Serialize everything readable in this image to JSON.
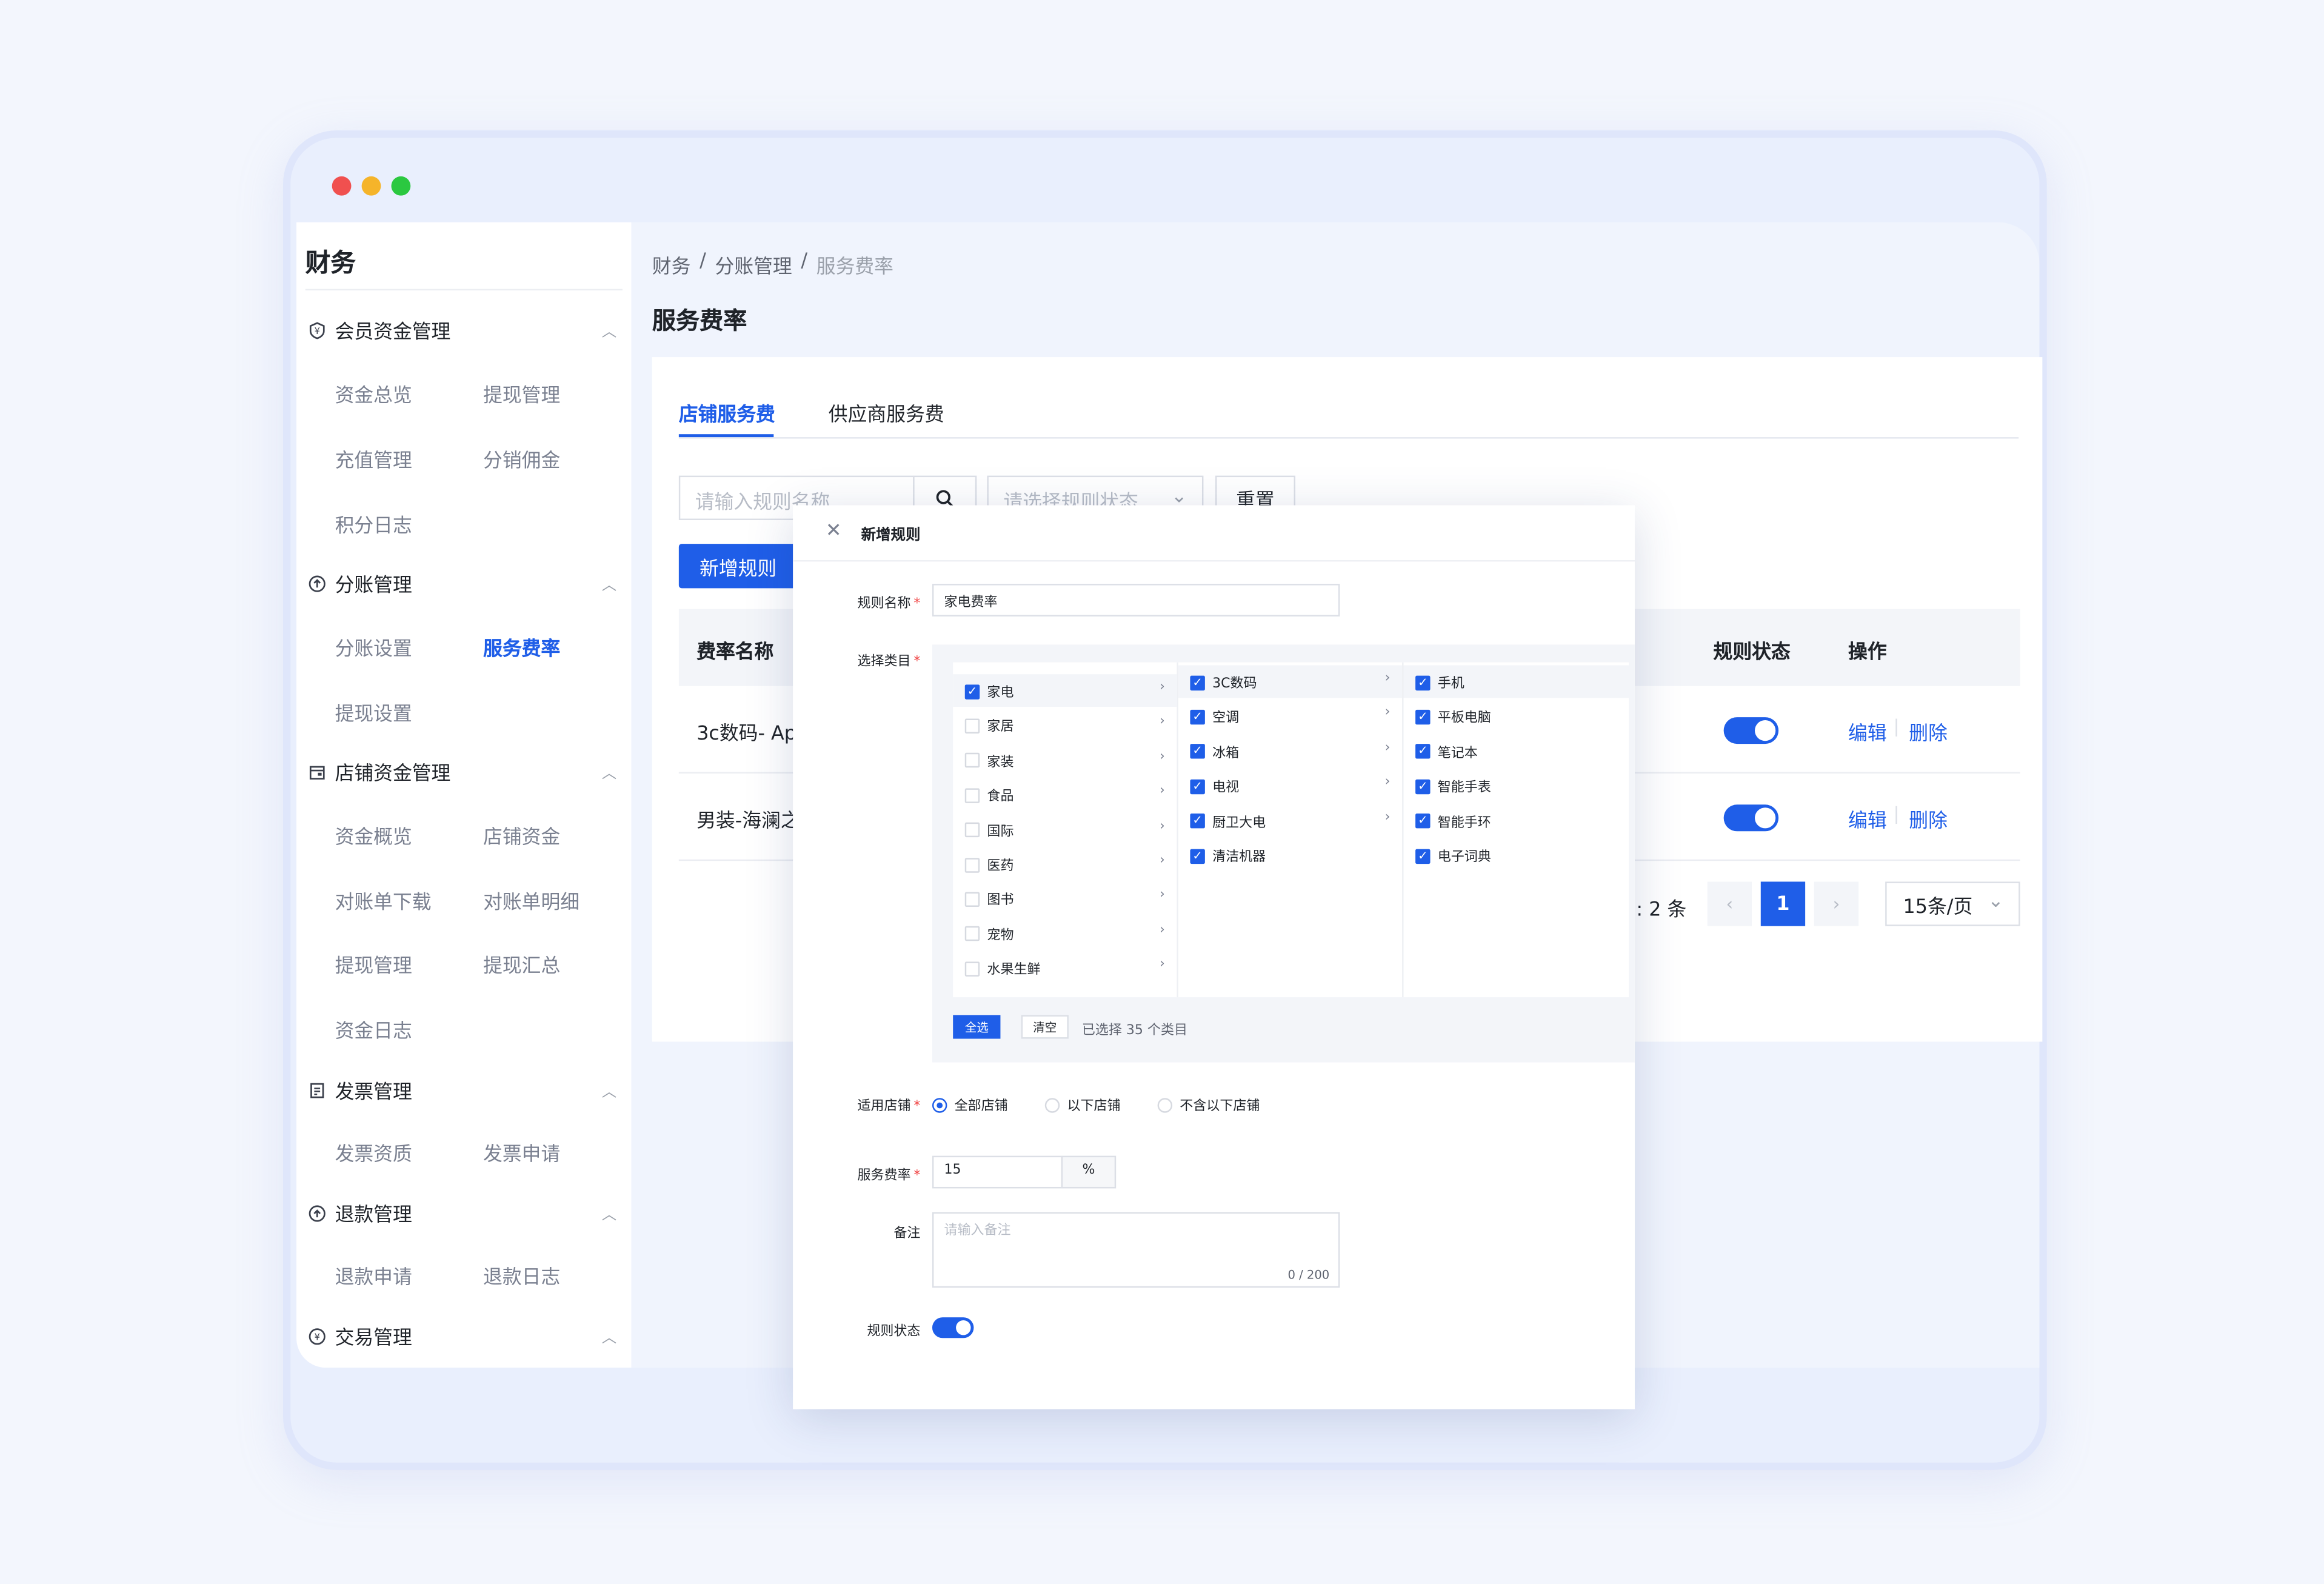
{
  "app": {
    "section_title": "财务"
  },
  "sidebar": {
    "groups": [
      {
        "label": "会员资金管理",
        "items": [
          "资金总览",
          "提现管理",
          "充值管理",
          "分销佣金",
          "积分日志"
        ]
      },
      {
        "label": "分账管理",
        "items": [
          "分账设置",
          "服务费率",
          "提现设置"
        ]
      },
      {
        "label": "店铺资金管理",
        "items": [
          "资金概览",
          "店铺资金",
          "对账单下载",
          "对账单明细",
          "提现管理",
          "提现汇总",
          "资金日志"
        ]
      },
      {
        "label": "发票管理",
        "items": [
          "发票资质",
          "发票申请"
        ]
      },
      {
        "label": "退款管理",
        "items": [
          "退款申请",
          "退款日志"
        ]
      },
      {
        "label": "交易管理",
        "items": []
      }
    ],
    "active_item": "服务费率"
  },
  "breadcrumb": [
    "财务",
    "分账管理",
    "服务费率"
  ],
  "page_title": "服务费率",
  "tabs": [
    "店铺服务费",
    "供应商服务费"
  ],
  "filters": {
    "name_placeholder": "请输入规则名称",
    "status_placeholder": "请选择规则状态",
    "reset_label": "重置"
  },
  "add_rule_label": "新增规则",
  "table": {
    "headers": {
      "name": "费率名称",
      "status": "规则状态",
      "actions": "操作"
    },
    "rows": [
      {
        "name": "3c数码- App",
        "status_on": true
      },
      {
        "name": "男装-海澜之",
        "status_on": true
      }
    ],
    "edit_label": "编辑",
    "delete_label": "删除"
  },
  "pagination": {
    "total_text": ": 2 条",
    "current_page": "1",
    "page_size": "15条/页"
  },
  "modal": {
    "title": "新增规则",
    "rule_name_label": "规则名称",
    "rule_name_value": "家电费率",
    "category_label": "选择类目",
    "col1": [
      "家电",
      "家居",
      "家装",
      "食品",
      "国际",
      "医药",
      "图书",
      "宠物",
      "水果生鲜"
    ],
    "col1_checked": [
      true,
      false,
      false,
      false,
      false,
      false,
      false,
      false,
      false
    ],
    "col2": [
      "3C数码",
      "空调",
      "冰箱",
      "电视",
      "厨卫大电",
      "清洁机器"
    ],
    "col2_arrow": [
      true,
      true,
      true,
      true,
      true,
      false
    ],
    "col3": [
      "手机",
      "平板电脑",
      "笔记本",
      "智能手表",
      "智能手环",
      "电子词典"
    ],
    "select_all_label": "全选",
    "clear_label": "清空",
    "selected_text": "已选择 35 个类目",
    "store_label": "适用店铺",
    "store_options": [
      "全部店铺",
      "以下店铺",
      "不含以下店铺"
    ],
    "store_selected": "全部店铺",
    "rate_label": "服务费率",
    "rate_value": "15",
    "rate_unit": "%",
    "remark_label": "备注",
    "remark_placeholder": "请输入备注",
    "remark_counter": "0 / 200",
    "status_label": "规则状态",
    "status_on": true
  },
  "colors": {
    "accent": "#1f5ee8",
    "background": "#f3f6fd",
    "window": "#e9effd"
  }
}
